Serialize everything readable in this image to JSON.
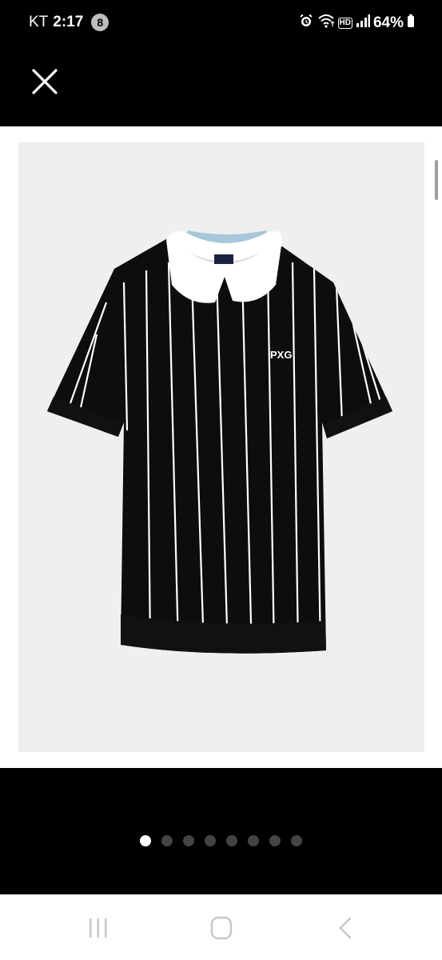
{
  "status_bar": {
    "carrier": "KT",
    "time": "2:17",
    "notification_count": "8",
    "battery": "64%"
  },
  "header": {
    "close_icon": "close-icon"
  },
  "image": {
    "subject": "black striped knit polo shirt with white collar",
    "logo_text": "PXG",
    "colors": {
      "shirt": "#0d0d0d",
      "stripes": "#ffffff",
      "collar": "#ffffff",
      "background": "#efefef"
    }
  },
  "carousel": {
    "total": 8,
    "active_index": 0
  },
  "nav": {
    "recents": "recents-icon",
    "home": "home-icon",
    "back": "back-icon"
  }
}
